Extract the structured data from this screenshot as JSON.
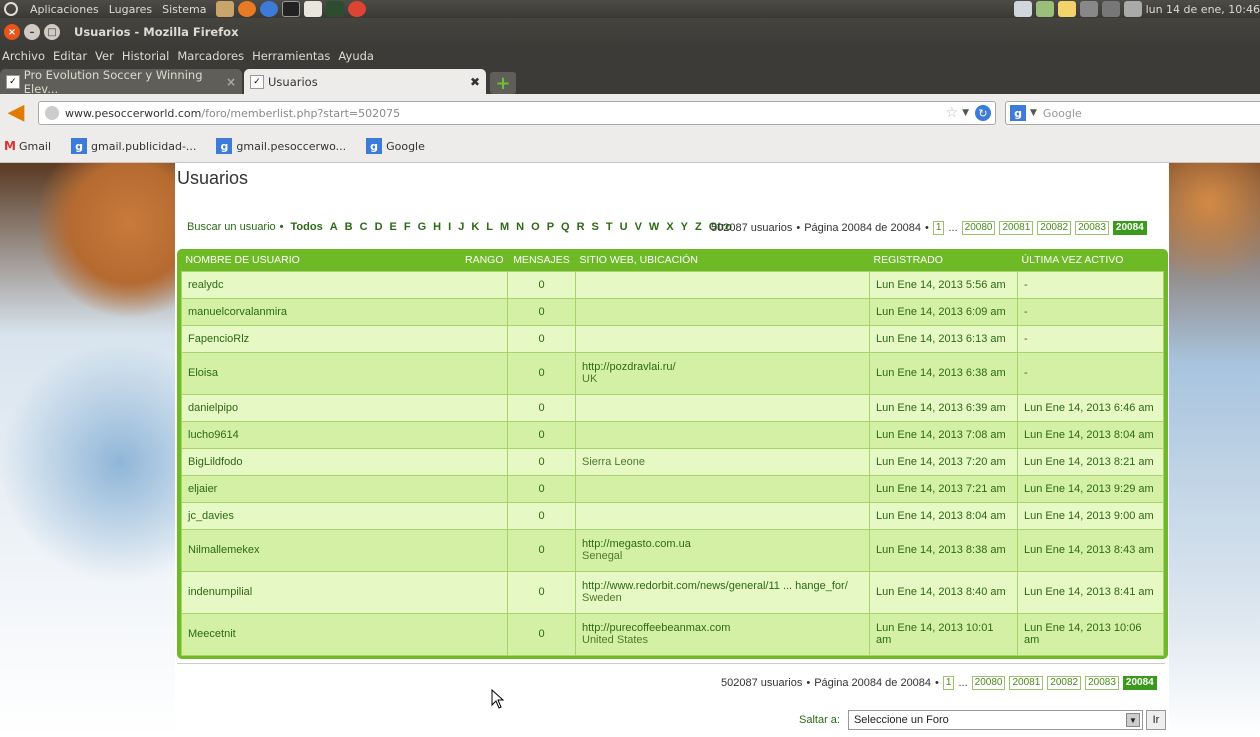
{
  "panel": {
    "menus": [
      "Aplicaciones",
      "Lugares",
      "Sistema"
    ],
    "clock": "lun 14 de ene, 10:46"
  },
  "window": {
    "title": "Usuarios - Mozilla Firefox"
  },
  "menubar": [
    "Archivo",
    "Editar",
    "Ver",
    "Historial",
    "Marcadores",
    "Herramientas",
    "Ayuda"
  ],
  "tabs": [
    {
      "label": "Pro Evolution Soccer y Winning Elev..."
    },
    {
      "label": "Usuarios"
    }
  ],
  "urlbar": {
    "domain": "www.pesoccerworld.com",
    "path": "/foro/memberlist.php?start=502075"
  },
  "searchbar": {
    "placeholder": "Google"
  },
  "bookmarks": [
    "Gmail",
    "gmail.publicidad-...",
    "gmail.pesoccerwo...",
    "Google"
  ],
  "page": {
    "title": "Usuarios",
    "find_user": "Buscar un usuario",
    "letters": [
      "Todos",
      "A",
      "B",
      "C",
      "D",
      "E",
      "F",
      "G",
      "H",
      "I",
      "J",
      "K",
      "L",
      "M",
      "N",
      "O",
      "P",
      "Q",
      "R",
      "S",
      "T",
      "U",
      "V",
      "W",
      "X",
      "Y",
      "Z",
      "Otro"
    ],
    "user_count": "502087 usuarios",
    "page_info": "Página 20084 de 20084",
    "pages": [
      "1",
      "20080",
      "20081",
      "20082",
      "20083",
      "20084"
    ],
    "ellipsis": "...",
    "bullet": "•",
    "columns": [
      "NOMBRE DE USUARIO",
      "RANGO",
      "MENSAJES",
      "SITIO WEB, UBICACIÓN",
      "REGISTRADO",
      "ÚLTIMA VEZ ACTIVO"
    ],
    "rows": [
      {
        "name": "realydc",
        "posts": "0",
        "web": "",
        "loc": "",
        "registered": "Lun Ene 14, 2013 5:56 am",
        "last": "-"
      },
      {
        "name": "manuelcorvalanmira",
        "posts": "0",
        "web": "",
        "loc": "",
        "registered": "Lun Ene 14, 2013 6:09 am",
        "last": "-"
      },
      {
        "name": "FapencioRlz",
        "posts": "0",
        "web": "",
        "loc": "",
        "registered": "Lun Ene 14, 2013 6:13 am",
        "last": "-"
      },
      {
        "name": "Eloisa",
        "posts": "0",
        "web": "http://pozdravlai.ru/",
        "loc": "UK",
        "registered": "Lun Ene 14, 2013 6:38 am",
        "last": "-"
      },
      {
        "name": "danielpipo",
        "posts": "0",
        "web": "",
        "loc": "",
        "registered": "Lun Ene 14, 2013 6:39 am",
        "last": "Lun Ene 14, 2013 6:46 am"
      },
      {
        "name": "lucho9614",
        "posts": "0",
        "web": "",
        "loc": "",
        "registered": "Lun Ene 14, 2013 7:08 am",
        "last": "Lun Ene 14, 2013 8:04 am"
      },
      {
        "name": "BigLildfodo",
        "posts": "0",
        "web": "",
        "loc": "Sierra Leone",
        "registered": "Lun Ene 14, 2013 7:20 am",
        "last": "Lun Ene 14, 2013 8:21 am"
      },
      {
        "name": "eljaier",
        "posts": "0",
        "web": "",
        "loc": "",
        "registered": "Lun Ene 14, 2013 7:21 am",
        "last": "Lun Ene 14, 2013 9:29 am"
      },
      {
        "name": "jc_davies",
        "posts": "0",
        "web": "",
        "loc": "",
        "registered": "Lun Ene 14, 2013 8:04 am",
        "last": "Lun Ene 14, 2013 9:00 am"
      },
      {
        "name": "Nilmallemekex",
        "posts": "0",
        "web": "http://megasto.com.ua",
        "loc": "Senegal",
        "registered": "Lun Ene 14, 2013 8:38 am",
        "last": "Lun Ene 14, 2013 8:43 am"
      },
      {
        "name": "indenumpilial",
        "posts": "0",
        "web": "http://www.redorbit.com/news/general/11 ... hange_for/",
        "loc": "Sweden",
        "registered": "Lun Ene 14, 2013 8:40 am",
        "last": "Lun Ene 14, 2013 8:41 am"
      },
      {
        "name": "Meecetnit",
        "posts": "0",
        "web": "http://purecoffeebeanmax.com",
        "loc": "United States",
        "registered": "Lun Ene 14, 2013 10:01 am",
        "last": "Lun Ene 14, 2013 10:06 am"
      }
    ],
    "jump_label": "Saltar a:",
    "jump_select": "Seleccione un Foro",
    "jump_button": "Ir"
  },
  "colors": {
    "accent": "#6dba26",
    "row_a": "#e6f8c4",
    "row_b": "#d4f0a4",
    "text": "#2c6a14"
  }
}
